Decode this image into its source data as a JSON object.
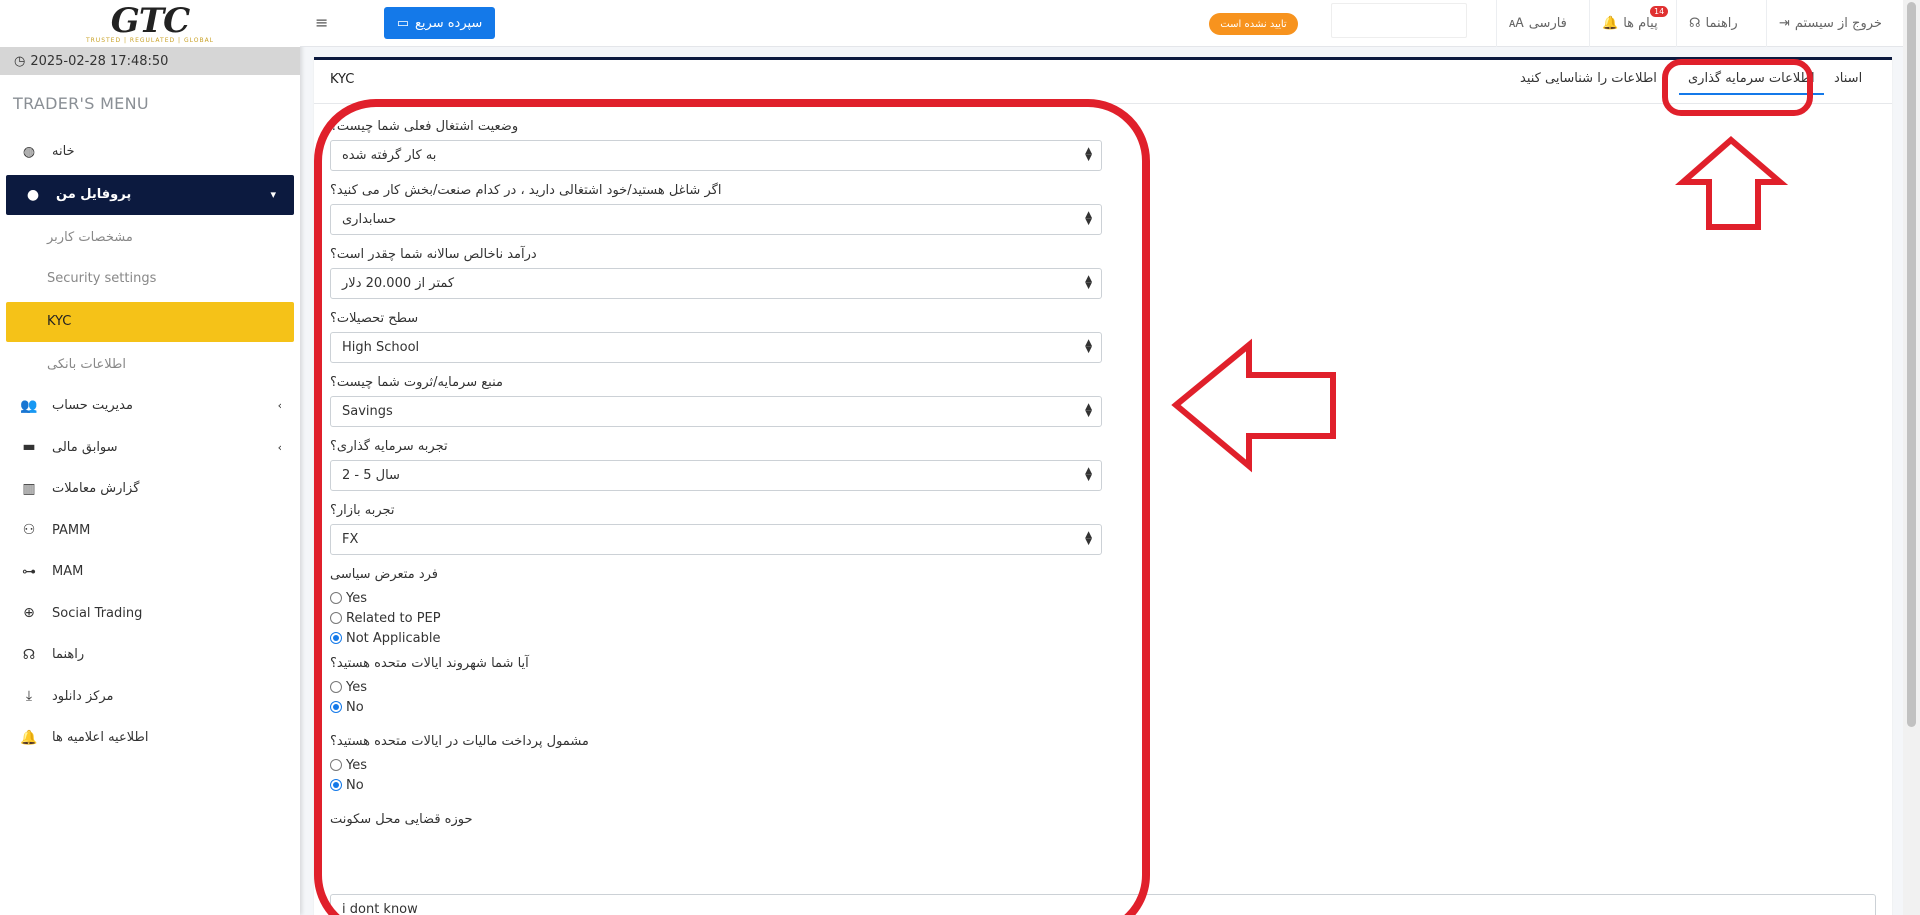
{
  "brand": {
    "logo": "GTC",
    "tagline": "TRUSTED | REGULATED | GLOBAL"
  },
  "datetime": "2025-02-28 17:48:50",
  "sidebar": {
    "title": "TRADER'S MENU",
    "items": [
      {
        "label": "خانه",
        "icon": "dashboard-icon"
      },
      {
        "label": "پروفایل من",
        "icon": "user-icon",
        "active": true
      },
      {
        "label": "مشخصات کاربر",
        "sub": true
      },
      {
        "label": "Security settings",
        "sub": true
      },
      {
        "label": "KYC",
        "sub": true,
        "selected": true
      },
      {
        "label": "اطلاعات بانکی",
        "sub": true
      },
      {
        "label": "مدیریت حساب",
        "icon": "users-icon"
      },
      {
        "label": "سوابق مالی",
        "icon": "card-icon"
      },
      {
        "label": "گزارش معاملات",
        "icon": "chart-icon"
      },
      {
        "label": "PAMM",
        "icon": "pamm-icon"
      },
      {
        "label": "MAM",
        "icon": "mam-icon"
      },
      {
        "label": "Social Trading",
        "icon": "globe-icon"
      },
      {
        "label": "راهنما",
        "icon": "support-icon"
      },
      {
        "label": "مرکز دانلود",
        "icon": "download-icon"
      },
      {
        "label": "اطلاعیه اعلامیه ها",
        "icon": "bell-icon"
      }
    ]
  },
  "topbar": {
    "quick_deposit": "سپرده سریع",
    "status_badge": "تایید نشده است",
    "language": "فارسی",
    "messages": "پیام ها",
    "messages_count": "14",
    "help": "راهنما",
    "logout": "خروج از سیستم"
  },
  "card": {
    "title": "KYC",
    "tabs": {
      "documents": "اسناد",
      "investment_info": "اطلاعات سرمایه گذاری",
      "identity_info": "اطلاعات را شناسایی کنید"
    }
  },
  "form": {
    "q1": {
      "label": "وضعیت اشتغال فعلی شما چیست؟",
      "value": "به کار گرفته شده"
    },
    "q2": {
      "label": "اگر شاغل هستید/خود اشتغالی دارید ، در کدام صنعت/بخش کار می کنید؟",
      "value": "حسابداری"
    },
    "q3": {
      "label": "درآمد ناخالص سالانه شما چقدر است؟",
      "value": "کمتر از 20.000 دلار"
    },
    "q4": {
      "label": "سطح تحصیلات؟",
      "value": "High School"
    },
    "q5": {
      "label": "منبع سرمایه/ثروت شما چیست؟",
      "value": "Savings"
    },
    "q6": {
      "label": "تجربه سرمایه گذاری؟",
      "value": "2 - 5 سال"
    },
    "q7": {
      "label": "تجربه بازار؟",
      "value": "FX"
    },
    "pep": {
      "label": "فرد متعرض سیاسی",
      "opt1": "Yes",
      "opt2": "Related to PEP",
      "opt3": "Not Applicable"
    },
    "us_citizen": {
      "label": "آیا شما شهروند ایالات متحده هستید؟",
      "opt1": "Yes",
      "opt2": "No"
    },
    "us_tax": {
      "label": "مشمول پرداخت مالیات در ایالات متحده هستید؟",
      "opt1": "Yes",
      "opt2": "No"
    },
    "residence": {
      "label": "حوزه قضایی محل سکونت",
      "value": "i dont know"
    }
  },
  "colors": {
    "navy": "#0c1a3f",
    "accent_yellow": "#f5c218",
    "primary_blue": "#1479e9",
    "warning_orange": "#f7931e",
    "annotation_red": "#e0202b"
  }
}
